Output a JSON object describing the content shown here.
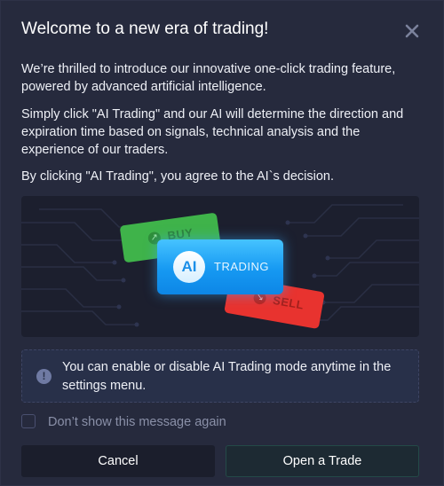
{
  "modal": {
    "title": "Welcome to a new era of trading!",
    "close_icon": "close-x-icon",
    "paragraphs": [
      "We’re thrilled to introduce our innovative one-click trading feature, powered by advanced artificial intelligence.",
      "Simply click \"AI Trading\" and our AI will determine the direction and expiration time based on signals, technical analysis and the experience of our traders.",
      "By clicking \"AI Trading\", you agree to the AI`s decision."
    ],
    "illustration": {
      "buy_label": "BUY",
      "sell_label": "SELL",
      "ai_badge": "AI",
      "ai_label": "TRADING",
      "buy_color": "#3fb34a",
      "sell_color": "#e8332f",
      "ai_color": "#1699f2"
    },
    "info": {
      "icon": "info-icon",
      "text": "You can enable or disable AI Trading mode anytime in the settings menu."
    },
    "checkbox": {
      "label": "Don’t show this message again",
      "checked": false
    },
    "buttons": {
      "cancel": "Cancel",
      "open_trade": "Open a Trade"
    }
  }
}
